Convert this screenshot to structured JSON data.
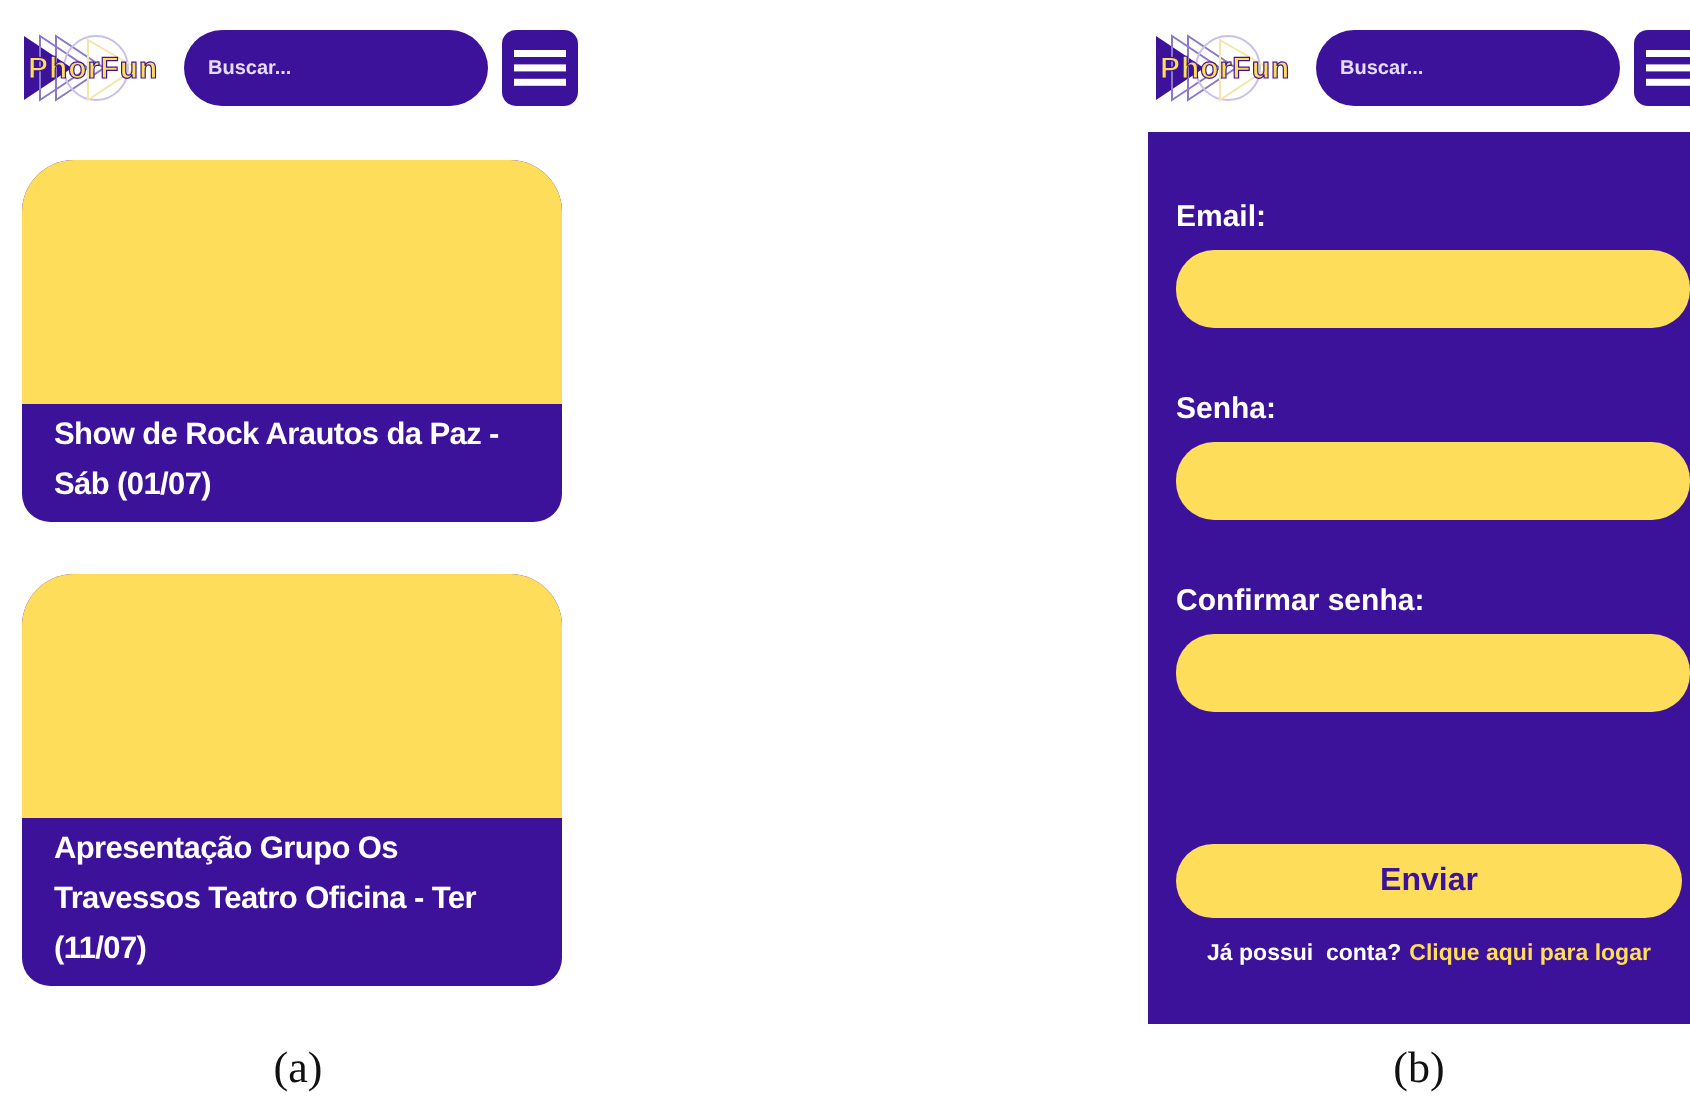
{
  "screens": [
    {
      "kind": "feed",
      "logo": "PhorFun",
      "search": {
        "placeholder": "Buscar..."
      },
      "cards": [
        {
          "title": "Show de Rock Arautos da Paz - Sáb (01/07)"
        },
        {
          "title": "Apresentação Grupo Os Travessos Teatro Oficina - Ter (11/07)"
        }
      ],
      "caption": "(a)"
    },
    {
      "kind": "signup",
      "logo": "PhorFun",
      "search": {
        "placeholder": "Buscar..."
      },
      "form": {
        "fields": [
          {
            "label": "Email:"
          },
          {
            "label": "Senha:"
          },
          {
            "label": "Confirmar senha:"
          }
        ],
        "submit": "Enviar",
        "footer": {
          "text": "Já possui  conta?",
          "link": "Clique aqui para logar"
        }
      },
      "caption": "(b)"
    }
  ]
}
